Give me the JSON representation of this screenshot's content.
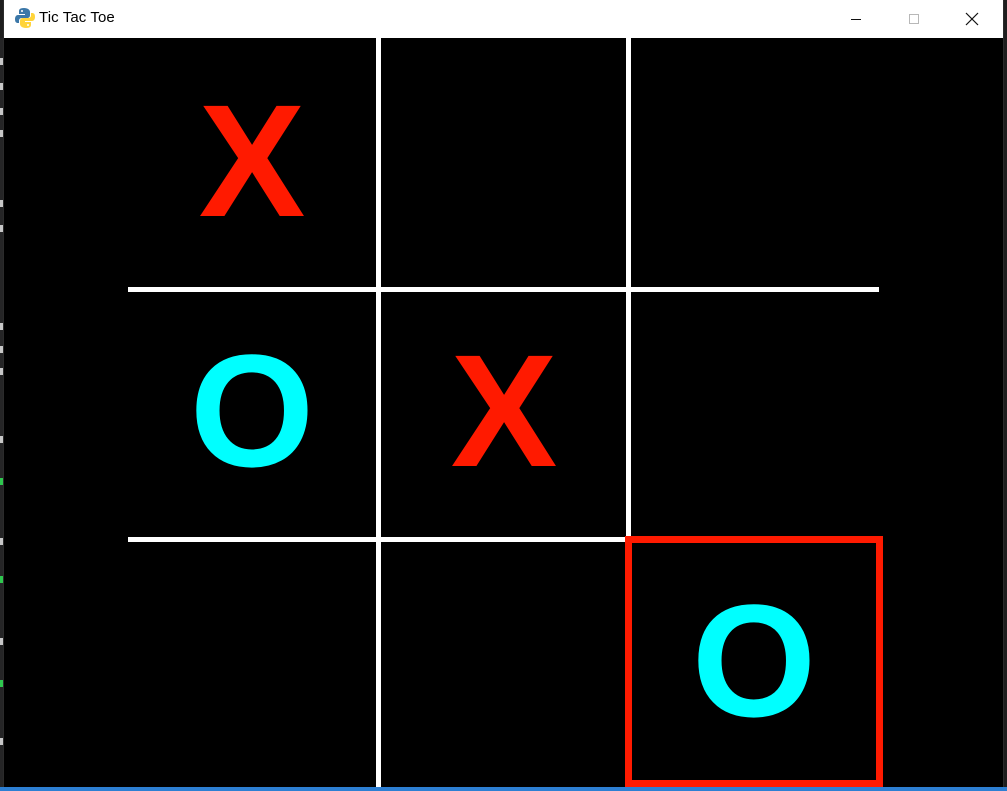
{
  "window": {
    "title": "Tic Tac Toe",
    "icon": "python-icon",
    "controls": {
      "minimize_icon": "minimize-icon",
      "maximize_icon": "maximize-icon",
      "close_icon": "close-icon"
    }
  },
  "board": {
    "cells": [
      {
        "mark": "X"
      },
      {
        "mark": ""
      },
      {
        "mark": ""
      },
      {
        "mark": "O"
      },
      {
        "mark": "X"
      },
      {
        "mark": ""
      },
      {
        "mark": ""
      },
      {
        "mark": ""
      },
      {
        "mark": "O"
      }
    ],
    "highlighted_cell": 8
  },
  "colors": {
    "x_color": "#ff1a00",
    "o_color": "#00ffff",
    "grid_color": "#ffffff",
    "highlight_color": "#ff1a00",
    "background": "#000000"
  }
}
